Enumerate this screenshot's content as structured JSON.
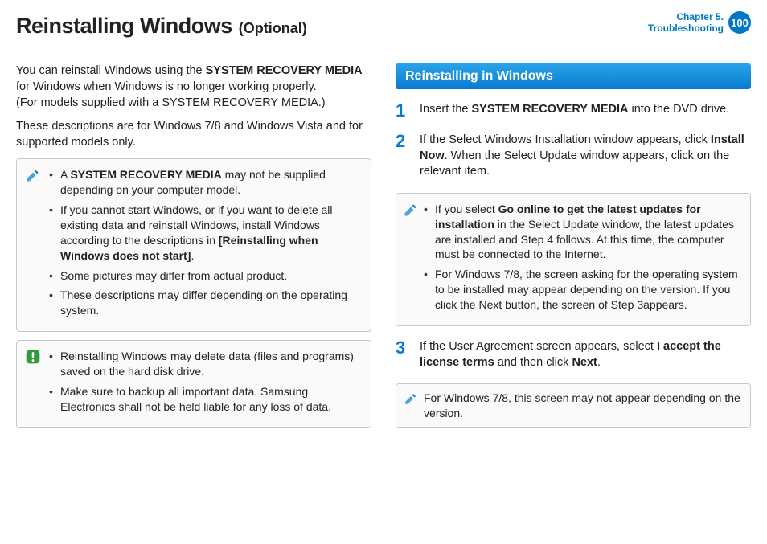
{
  "header": {
    "title_main": "Reinstalling Windows",
    "title_sub": "(Optional)",
    "chapter_line1": "Chapter 5.",
    "chapter_line2": "Troubleshooting",
    "page_no": "100"
  },
  "left": {
    "intro_a_pre": "You can reinstall Windows using the ",
    "intro_a_bold": "SYSTEM RECOVERY MEDIA",
    "intro_a_post": " for Windows when Windows is no longer working properly.",
    "intro_b": "(For models supplied with a SYSTEM RECOVERY MEDIA.)",
    "intro_c": "These descriptions are for Windows 7/8 and Windows Vista and for supported models only.",
    "box1": {
      "i1_pre": "A ",
      "i1_bold": "SYSTEM RECOVERY MEDIA",
      "i1_post": " may not be supplied depending on your computer model.",
      "i2_pre": "If you cannot start Windows, or if you want to delete all existing data and reinstall Windows, install Windows according to the descriptions in ",
      "i2_bold": "[Reinstalling when Windows does not start]",
      "i2_post": ".",
      "i3": "Some pictures may differ from actual product.",
      "i4": "These descriptions may differ depending on the operating system."
    },
    "box2": {
      "i1": "Reinstalling Windows may delete data (files and programs) saved on the hard disk drive.",
      "i2": "Make sure to backup all important data. Samsung Electronics shall not be held liable for any loss of data."
    }
  },
  "right": {
    "section_title": "Reinstalling in Windows",
    "steps": {
      "s1_pre": "Insert the ",
      "s1_bold": "SYSTEM RECOVERY MEDIA",
      "s1_post": " into the DVD drive.",
      "s2_pre": "If the Select Windows Installation window appears, click ",
      "s2_bold": "Install Now",
      "s2_post": ". When the Select Update window appears, click on the relevant item.",
      "s3_pre": "If the User Agreement screen appears, select ",
      "s3_bold1": "I accept the license terms",
      "s3_mid": " and then click ",
      "s3_bold2": "Next",
      "s3_post": "."
    },
    "box1": {
      "i1_pre": "If you select ",
      "i1_bold": "Go online to get the latest updates for installation",
      "i1_post": " in the Select Update window, the latest updates are installed and Step 4 follows. At this time, the computer must be connected to the Internet.",
      "i2": "For Windows 7/8, the screen asking for the operating system to be installed may appear depending on the version. If you click the Next button, the screen of Step 3appears."
    },
    "note2": "For Windows 7/8, this screen may not appear depending on the version."
  },
  "step_numbers": {
    "n1": "1",
    "n2": "2",
    "n3": "3"
  }
}
